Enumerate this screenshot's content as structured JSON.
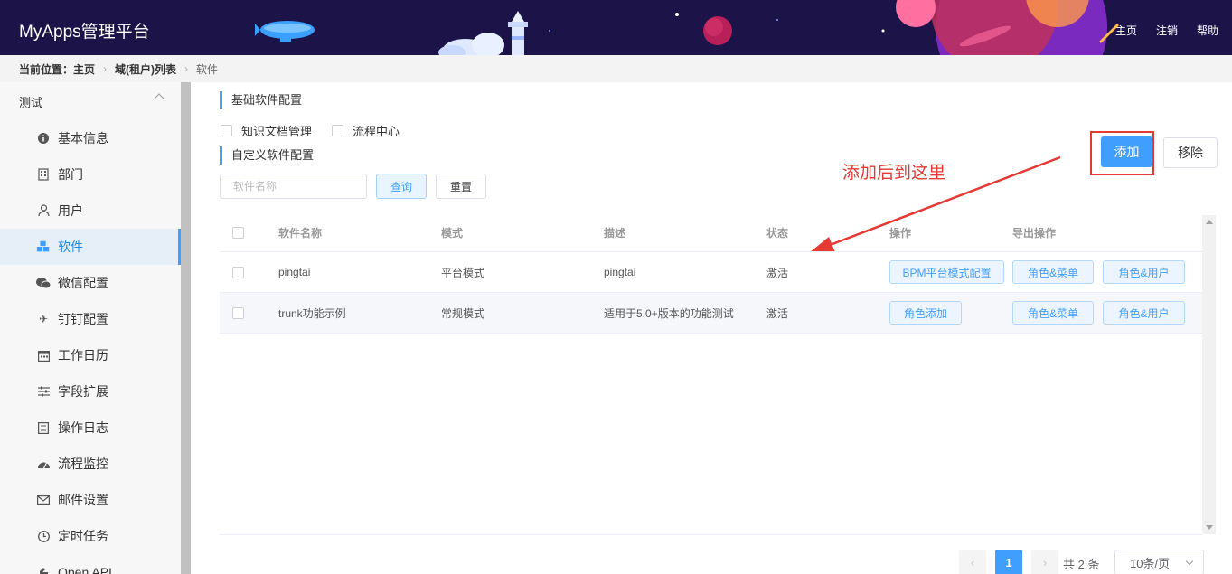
{
  "header": {
    "title": "MyApps管理平台",
    "links": [
      "主页",
      "注销",
      "帮助"
    ]
  },
  "breadcrumb": {
    "label": "当前位置：主页",
    "items": [
      "域(租户)列表",
      "软件"
    ]
  },
  "sidebar": {
    "group": "测试",
    "items": [
      {
        "label": "基本信息",
        "icon": "info-icon"
      },
      {
        "label": "部门",
        "icon": "building-icon"
      },
      {
        "label": "用户",
        "icon": "user-icon"
      },
      {
        "label": "软件",
        "icon": "cubes-icon",
        "active": true
      },
      {
        "label": "微信配置",
        "icon": "wechat-icon"
      },
      {
        "label": "钉钉配置",
        "icon": "plane-icon"
      },
      {
        "label": "工作日历",
        "icon": "calendar-icon"
      },
      {
        "label": "字段扩展",
        "icon": "sliders-icon"
      },
      {
        "label": "操作日志",
        "icon": "log-icon"
      },
      {
        "label": "流程监控",
        "icon": "dashboard-icon"
      },
      {
        "label": "邮件设置",
        "icon": "mail-icon"
      },
      {
        "label": "定时任务",
        "icon": "clock-icon"
      },
      {
        "label": "Open API",
        "icon": "api-icon"
      }
    ]
  },
  "main": {
    "basic_title": "基础软件配置",
    "basic_checks": [
      "知识文档管理",
      "流程中心"
    ],
    "custom_title": "自定义软件配置",
    "search_placeholder": "软件名称",
    "query_label": "查询",
    "reset_label": "重置",
    "add_label": "添加",
    "remove_label": "移除",
    "annotation": "添加后到这里"
  },
  "table": {
    "headers": [
      "软件名称",
      "模式",
      "描述",
      "状态",
      "操作",
      "导出操作"
    ],
    "rows": [
      {
        "name": "pingtai",
        "mode": "平台模式",
        "desc": "pingtai",
        "status": "激活",
        "op": "BPM平台模式配置",
        "export1": "角色&菜单",
        "export2": "角色&用户"
      },
      {
        "name": "trunk功能示例",
        "mode": "常规模式",
        "desc": "适用于5.0+版本的功能测试",
        "status": "激活",
        "op": "角色添加",
        "export1": "角色&菜单",
        "export2": "角色&用户"
      }
    ]
  },
  "pagination": {
    "current": "1",
    "total": "共 2 条",
    "page_size": "10条/页"
  },
  "colors": {
    "primary": "#409eff",
    "header_bg": "#1c1448",
    "annotation": "#e53935"
  }
}
